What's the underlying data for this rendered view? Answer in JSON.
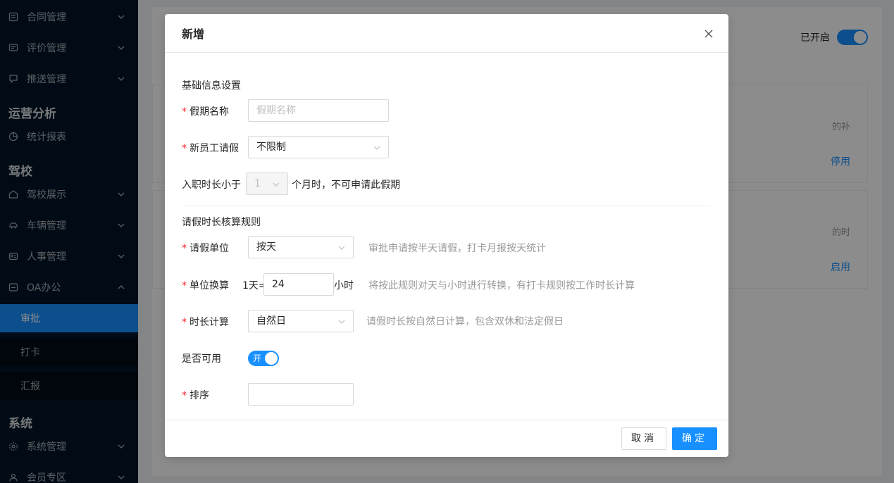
{
  "sidebar": {
    "items_top": [
      {
        "label": "合同管理",
        "icon": "contract-icon"
      },
      {
        "label": "评价管理",
        "icon": "comment-icon"
      },
      {
        "label": "推送管理",
        "icon": "push-icon"
      }
    ],
    "group_ops": "运营分析",
    "item_stats": "统计报表",
    "group_school": "驾校",
    "items_school": [
      {
        "label": "驾校展示",
        "icon": "school-icon"
      },
      {
        "label": "车辆管理",
        "icon": "car-icon"
      },
      {
        "label": "人事管理",
        "icon": "personnel-icon"
      },
      {
        "label": "OA办公",
        "icon": "office-icon"
      }
    ],
    "sub_items": [
      {
        "label": "审批"
      },
      {
        "label": "打卡"
      },
      {
        "label": "汇报"
      }
    ],
    "group_system": "系统",
    "items_system": [
      {
        "label": "系统管理",
        "icon": "settings-icon"
      },
      {
        "label": "会员专区",
        "icon": "member-icon"
      }
    ]
  },
  "background": {
    "status_label": "已开启",
    "card1_snippet": "的补",
    "card1_link": "停用",
    "card2_snippet": "的时",
    "card2_link": "启用"
  },
  "modal": {
    "title": "新增",
    "section_basic": "基础信息设置",
    "holiday_name_label": "假期名称",
    "holiday_name_placeholder": "假期名称",
    "new_employee_label": "新员工请假",
    "new_employee_value": "不限制",
    "tenure_prefix": "入职时长小于",
    "tenure_value": "1",
    "tenure_suffix": "个月时，不可申请此假期",
    "section_rule": "请假时长核算规则",
    "unit_label": "请假单位",
    "unit_value": "按天",
    "unit_hint": "审批申请按半天请假，打卡月报按天统计",
    "convert_label": "单位换算",
    "convert_prefix": "1天=",
    "convert_value": "24",
    "convert_suffix": "小时",
    "convert_hint": "将按此规则对天与小时进行转换，有打卡规则按工作时长计算",
    "calc_label": "时长计算",
    "calc_value": "自然日",
    "calc_hint": "请假时长按自然日计算，包含双休和法定假日",
    "available_label": "是否可用",
    "available_switch_text": "开",
    "sort_label": "排序",
    "sort_value": "",
    "cancel_label": "取消",
    "ok_label": "确定"
  },
  "colors": {
    "primary": "#1890ff",
    "required": "#f5222d",
    "sidebar_bg": "#001529"
  }
}
